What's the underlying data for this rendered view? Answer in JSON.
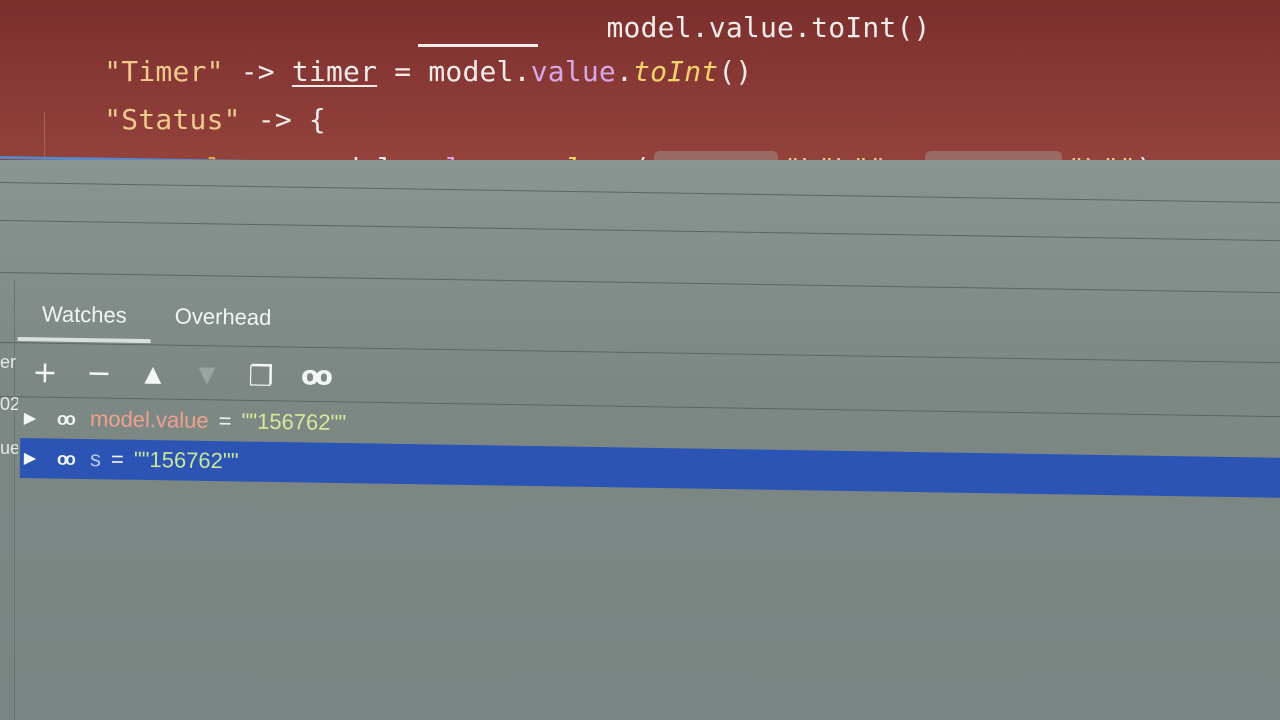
{
  "editor": {
    "lines": [
      {
        "str": "\"Timer\"",
        "arrow": " -> ",
        "var": "timer",
        "rest_a": " = model.",
        "prop": "value",
        "dot": ".",
        "fn": "toInt",
        "tail": "()"
      },
      {
        "str": "\"Status\"",
        "arrow": " -> {"
      },
      {
        "kw": "val",
        "mid": " s = model.",
        "prop": "value",
        "dot": ".",
        "fn": "replace",
        "paren": "(",
        "hint1": "oldValue:",
        "arg1": "\"\\\"\\\"\",",
        "hint2": "newValue:",
        "arg2": "\"\\\"\"",
        "close": ")"
      }
    ]
  },
  "left_fragments": [
    "er",
    "02",
    "ue"
  ],
  "tabs": [
    {
      "label": "Watches",
      "active": true
    },
    {
      "label": "Overhead",
      "active": false
    }
  ],
  "toolbar": {
    "add": "+",
    "remove": "−",
    "up": "▲",
    "down": "▼",
    "copy": "❐",
    "glasses": "oo"
  },
  "watches": [
    {
      "name": "model.value",
      "eq": "=",
      "value": "\"\"156762\"\"",
      "icon": "oo",
      "expand": "▶",
      "selected": false
    },
    {
      "name": "s",
      "eq": "=",
      "value": "\"\"156762\"\"",
      "icon": "oo",
      "expand": "▶",
      "selected": true
    }
  ],
  "colors": {
    "editor_bg": "#8a3a36",
    "panel_bg": "#7d8885",
    "selection": "#2c54b5",
    "string": "#f0c98c",
    "keyword": "#f0a53a"
  }
}
